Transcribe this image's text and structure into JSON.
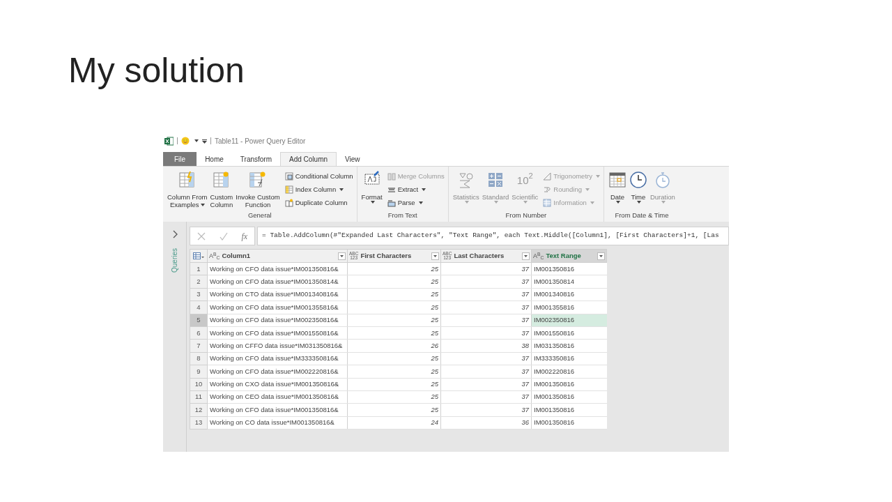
{
  "slide_title": "My solution",
  "window": {
    "title": "Table11 - Power Query Editor"
  },
  "tabs": [
    {
      "label": "File",
      "kind": "file",
      "selected": false
    },
    {
      "label": "Home",
      "kind": "tab",
      "selected": false
    },
    {
      "label": "Transform",
      "kind": "tab",
      "selected": false
    },
    {
      "label": "Add Column",
      "kind": "tab",
      "selected": true
    },
    {
      "label": "View",
      "kind": "tab",
      "selected": false
    }
  ],
  "ribbon_groups": [
    {
      "label": "General",
      "large": [
        {
          "lines": [
            "Column From",
            "Examples"
          ],
          "dropdown": true,
          "disabled": false
        },
        {
          "lines": [
            "Custom",
            "Column"
          ],
          "dropdown": false,
          "disabled": false
        },
        {
          "lines": [
            "Invoke Custom",
            "Function"
          ],
          "dropdown": false,
          "disabled": false
        }
      ],
      "small": [
        {
          "label": "Conditional Column",
          "dropdown": false,
          "disabled": false
        },
        {
          "label": "Index Column",
          "dropdown": true,
          "disabled": false
        },
        {
          "label": "Duplicate Column",
          "dropdown": false,
          "disabled": false
        }
      ]
    },
    {
      "label": "From Text",
      "large": [
        {
          "lines": [
            "Format"
          ],
          "dropdown": true,
          "disabled": false
        }
      ],
      "small": [
        {
          "label": "Merge Columns",
          "dropdown": false,
          "disabled": true
        },
        {
          "label": "Extract",
          "dropdown": true,
          "disabled": false
        },
        {
          "label": "Parse",
          "dropdown": true,
          "disabled": false
        }
      ]
    },
    {
      "label": "From Number",
      "large": [
        {
          "lines": [
            "Statistics"
          ],
          "dropdown": true,
          "disabled": true
        },
        {
          "lines": [
            "Standard"
          ],
          "dropdown": true,
          "disabled": true
        },
        {
          "lines": [
            "Scientific"
          ],
          "dropdown": true,
          "disabled": true,
          "icon_text": "10$^{2}$"
        }
      ],
      "small": [
        {
          "label": "Trigonometry",
          "dropdown": true,
          "disabled": true
        },
        {
          "label": "Rounding",
          "dropdown": true,
          "disabled": true
        },
        {
          "label": "Information",
          "dropdown": true,
          "disabled": true
        }
      ]
    },
    {
      "label": "From Date & Time",
      "large": [
        {
          "lines": [
            "Date"
          ],
          "dropdown": true,
          "disabled": false
        },
        {
          "lines": [
            "Time"
          ],
          "dropdown": true,
          "disabled": false
        },
        {
          "lines": [
            "Duration"
          ],
          "dropdown": true,
          "disabled": true
        }
      ]
    }
  ],
  "queries_pane": {
    "label": "Queries",
    "expanded": false
  },
  "formula_bar": {
    "fx": "fx",
    "formula": "= Table.AddColumn(#\"Expanded Last Characters\", \"Text Range\", each Text.Middle([Column1], [First Characters]+1, [Las"
  },
  "table": {
    "columns": [
      {
        "name": "Column1",
        "type_label": [
          "A$^{B}$$_{C}$"
        ],
        "selected": false
      },
      {
        "name": "First Characters",
        "type_label": [
          "ABC",
          "123"
        ],
        "selected": false
      },
      {
        "name": "Last Characters",
        "type_label": [
          "ABC",
          "123"
        ],
        "selected": false
      },
      {
        "name": "Text Range",
        "type_label": [
          "A$^{B}$$_{C}$"
        ],
        "selected": true
      }
    ],
    "rows": [
      {
        "n": "1",
        "cells": [
          "Working on CFO data issue*IM001350816&",
          "25",
          "37",
          "IM001350816"
        ],
        "selected": false
      },
      {
        "n": "2",
        "cells": [
          "Working on CFO data issue*IM001350814&",
          "25",
          "37",
          "IM001350814"
        ],
        "selected": false
      },
      {
        "n": "3",
        "cells": [
          "Working on CTO data issue*IM001340816&",
          "25",
          "37",
          "IM001340816"
        ],
        "selected": false
      },
      {
        "n": "4",
        "cells": [
          "Working on CFO data issue*IM001355816&",
          "25",
          "37",
          "IM001355816"
        ],
        "selected": false
      },
      {
        "n": "5",
        "cells": [
          "Working on CFO data issue*IM002350816&",
          "25",
          "37",
          "IM002350816"
        ],
        "selected": true
      },
      {
        "n": "6",
        "cells": [
          "Working on CFO data issue*IM001550816&",
          "25",
          "37",
          "IM001550816"
        ],
        "selected": false
      },
      {
        "n": "7",
        "cells": [
          "Working on CFFO data issue*IM031350816&",
          "26",
          "38",
          "IM031350816"
        ],
        "selected": false
      },
      {
        "n": "8",
        "cells": [
          "Working on CFO data issue*IM333350816&",
          "25",
          "37",
          "IM333350816"
        ],
        "selected": false
      },
      {
        "n": "9",
        "cells": [
          "Working on CFO data issue*IM002220816&",
          "25",
          "37",
          "IM002220816"
        ],
        "selected": false
      },
      {
        "n": "10",
        "cells": [
          "Working on CXO data issue*IM001350816&",
          "25",
          "37",
          "IM001350816"
        ],
        "selected": false
      },
      {
        "n": "11",
        "cells": [
          "Working on CEO data issue*IM001350816&",
          "25",
          "37",
          "IM001350816"
        ],
        "selected": false
      },
      {
        "n": "12",
        "cells": [
          "Working on CFO data issue*IM001350816&",
          "25",
          "37",
          "IM001350816"
        ],
        "selected": false
      },
      {
        "n": "13",
        "cells": [
          "Working on CO data issue*IM001350816&",
          "24",
          "36",
          "IM001350816"
        ],
        "selected": false
      }
    ]
  }
}
